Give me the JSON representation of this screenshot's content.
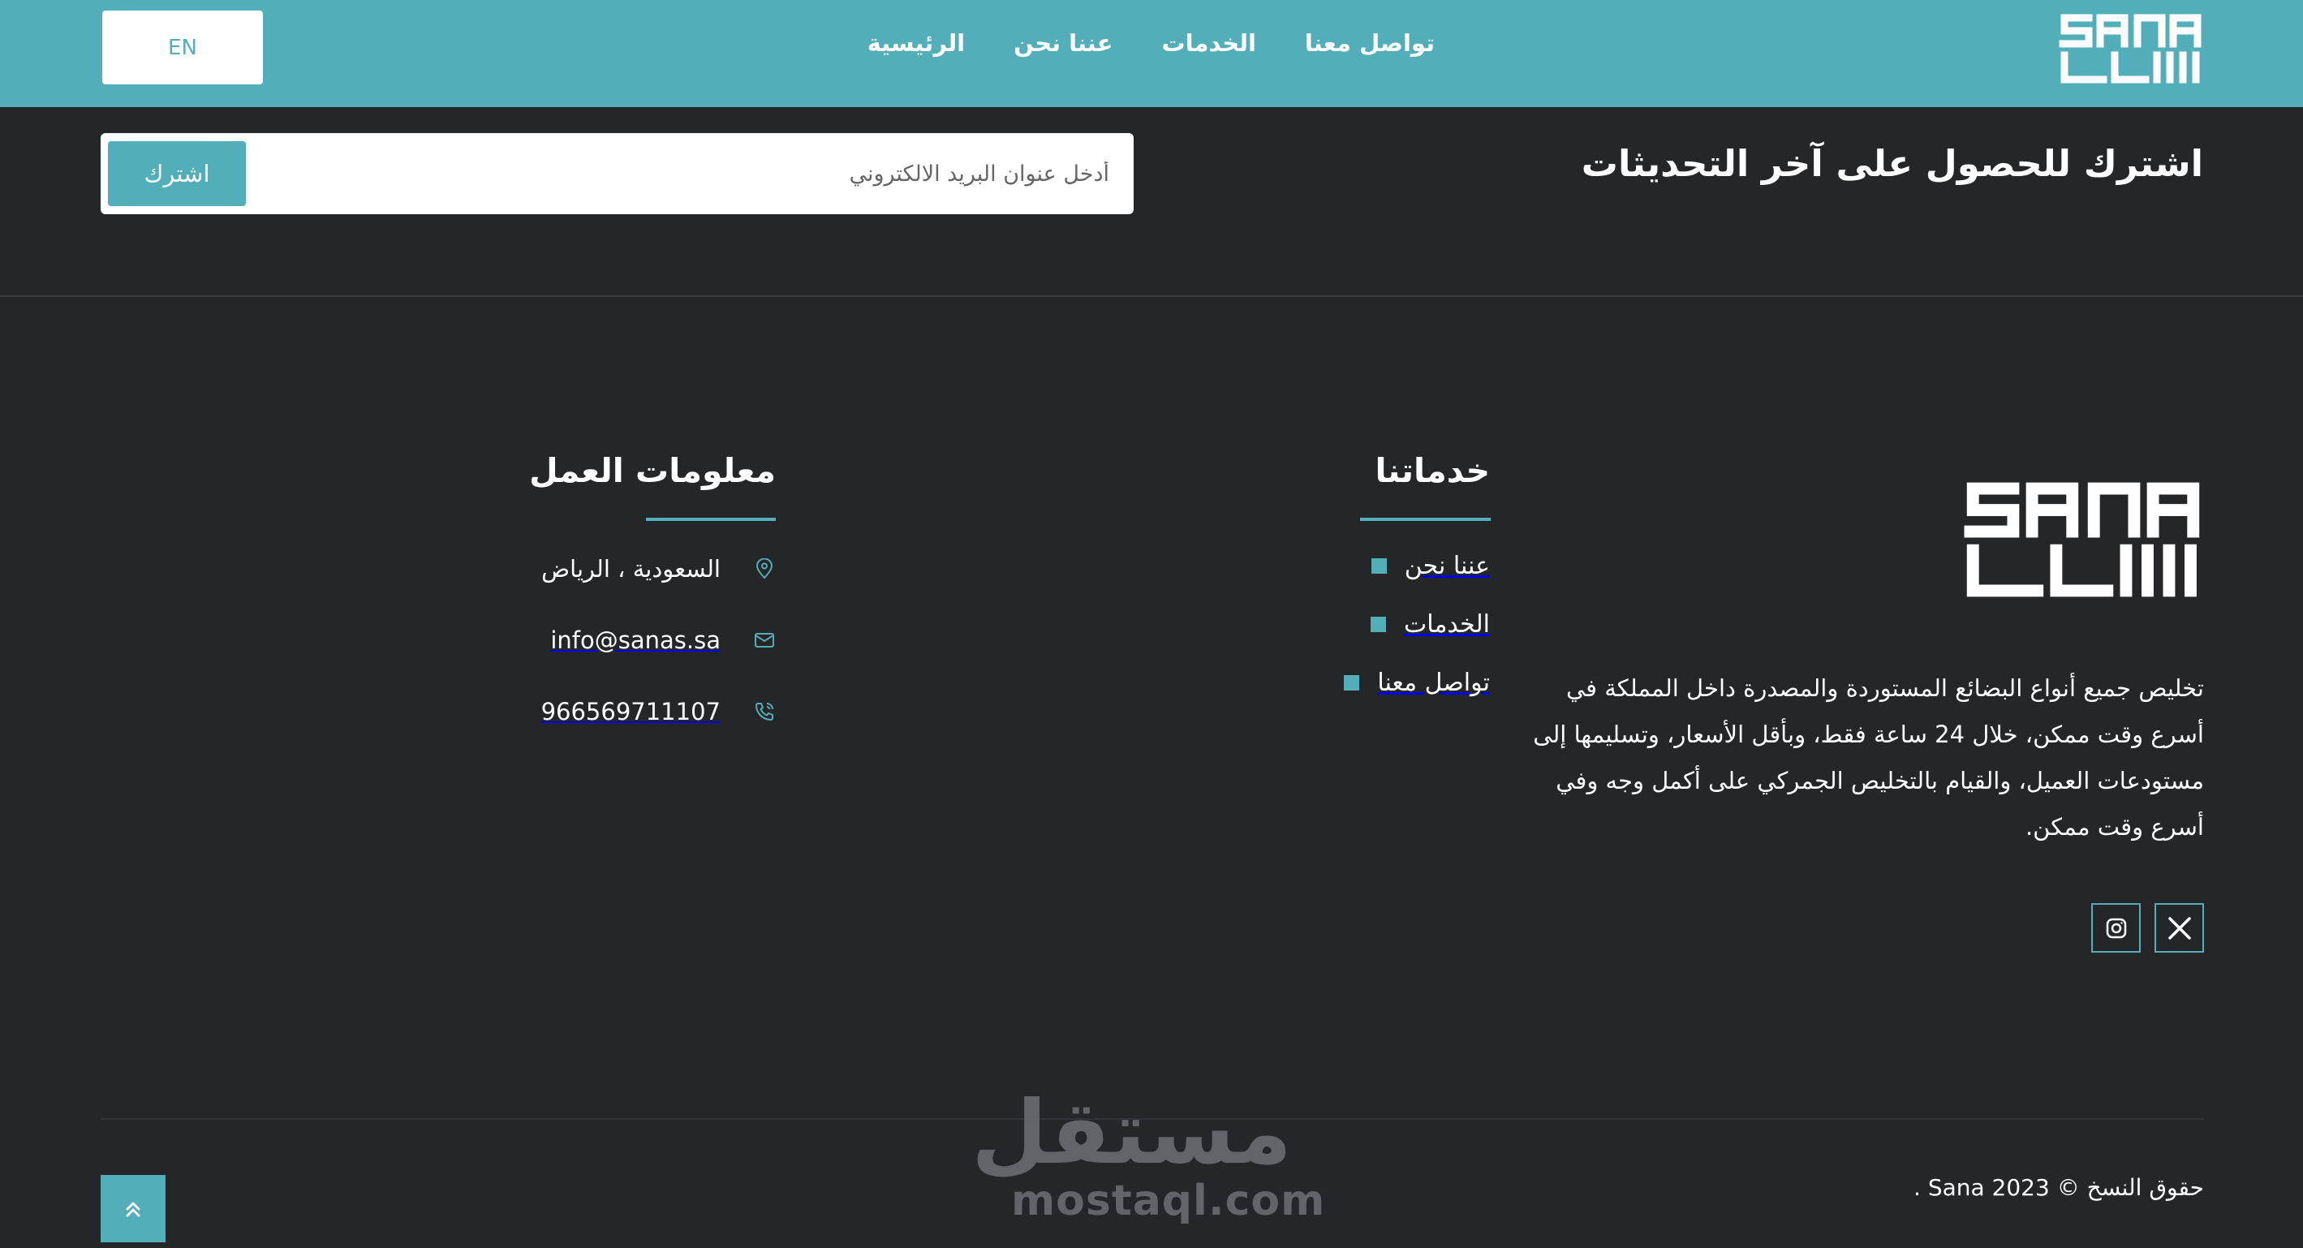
{
  "header": {
    "lang_label": "EN",
    "nav": [
      "الرئيسية",
      "عننا نحن",
      "الخدمات",
      "تواصل معنا"
    ],
    "logo_icon": "sana-logo-icon"
  },
  "subscribe": {
    "title": "اشترك للحصول على آخر التحديثات",
    "email_placeholder": "أدخل عنوان البريد الالكتروني",
    "button_label": "اشترك"
  },
  "about": {
    "logo_icon": "sana-logo-icon",
    "text": "تخليص جميع أنواع البضائع المستوردة والمصدرة داخل المملكة في أسرع وقت ممكن، خلال 24 ساعة فقط، وبأقل الأسعار، وتسليمها إلى مستودعات العميل، والقيام بالتخليص الجمركي على أكمل وجه وفي أسرع وقت ممكن.",
    "social": [
      "x-icon",
      "instagram-icon"
    ]
  },
  "services": {
    "title": "خدماتنا",
    "items": [
      "عننا نحن",
      "الخدمات",
      "تواصل معنا"
    ]
  },
  "work_info": {
    "title": "معلومات العمل",
    "items": [
      {
        "icon": "location-pin-icon",
        "label": "السعودية ، الرياض"
      },
      {
        "icon": "mail-icon",
        "label": "info@sanas.sa"
      },
      {
        "icon": "phone-icon",
        "label": "966569711107"
      }
    ]
  },
  "footer": {
    "copyright": "حقوق النسخ © Sana 2023 .",
    "scroll_top_icon": "chevrons-up-icon"
  },
  "watermark": {
    "arabic": "مستقل",
    "latin": "mostaql.com"
  },
  "colors": {
    "accent": "#52aeb8",
    "background": "#252628",
    "text": "#ffffff"
  }
}
